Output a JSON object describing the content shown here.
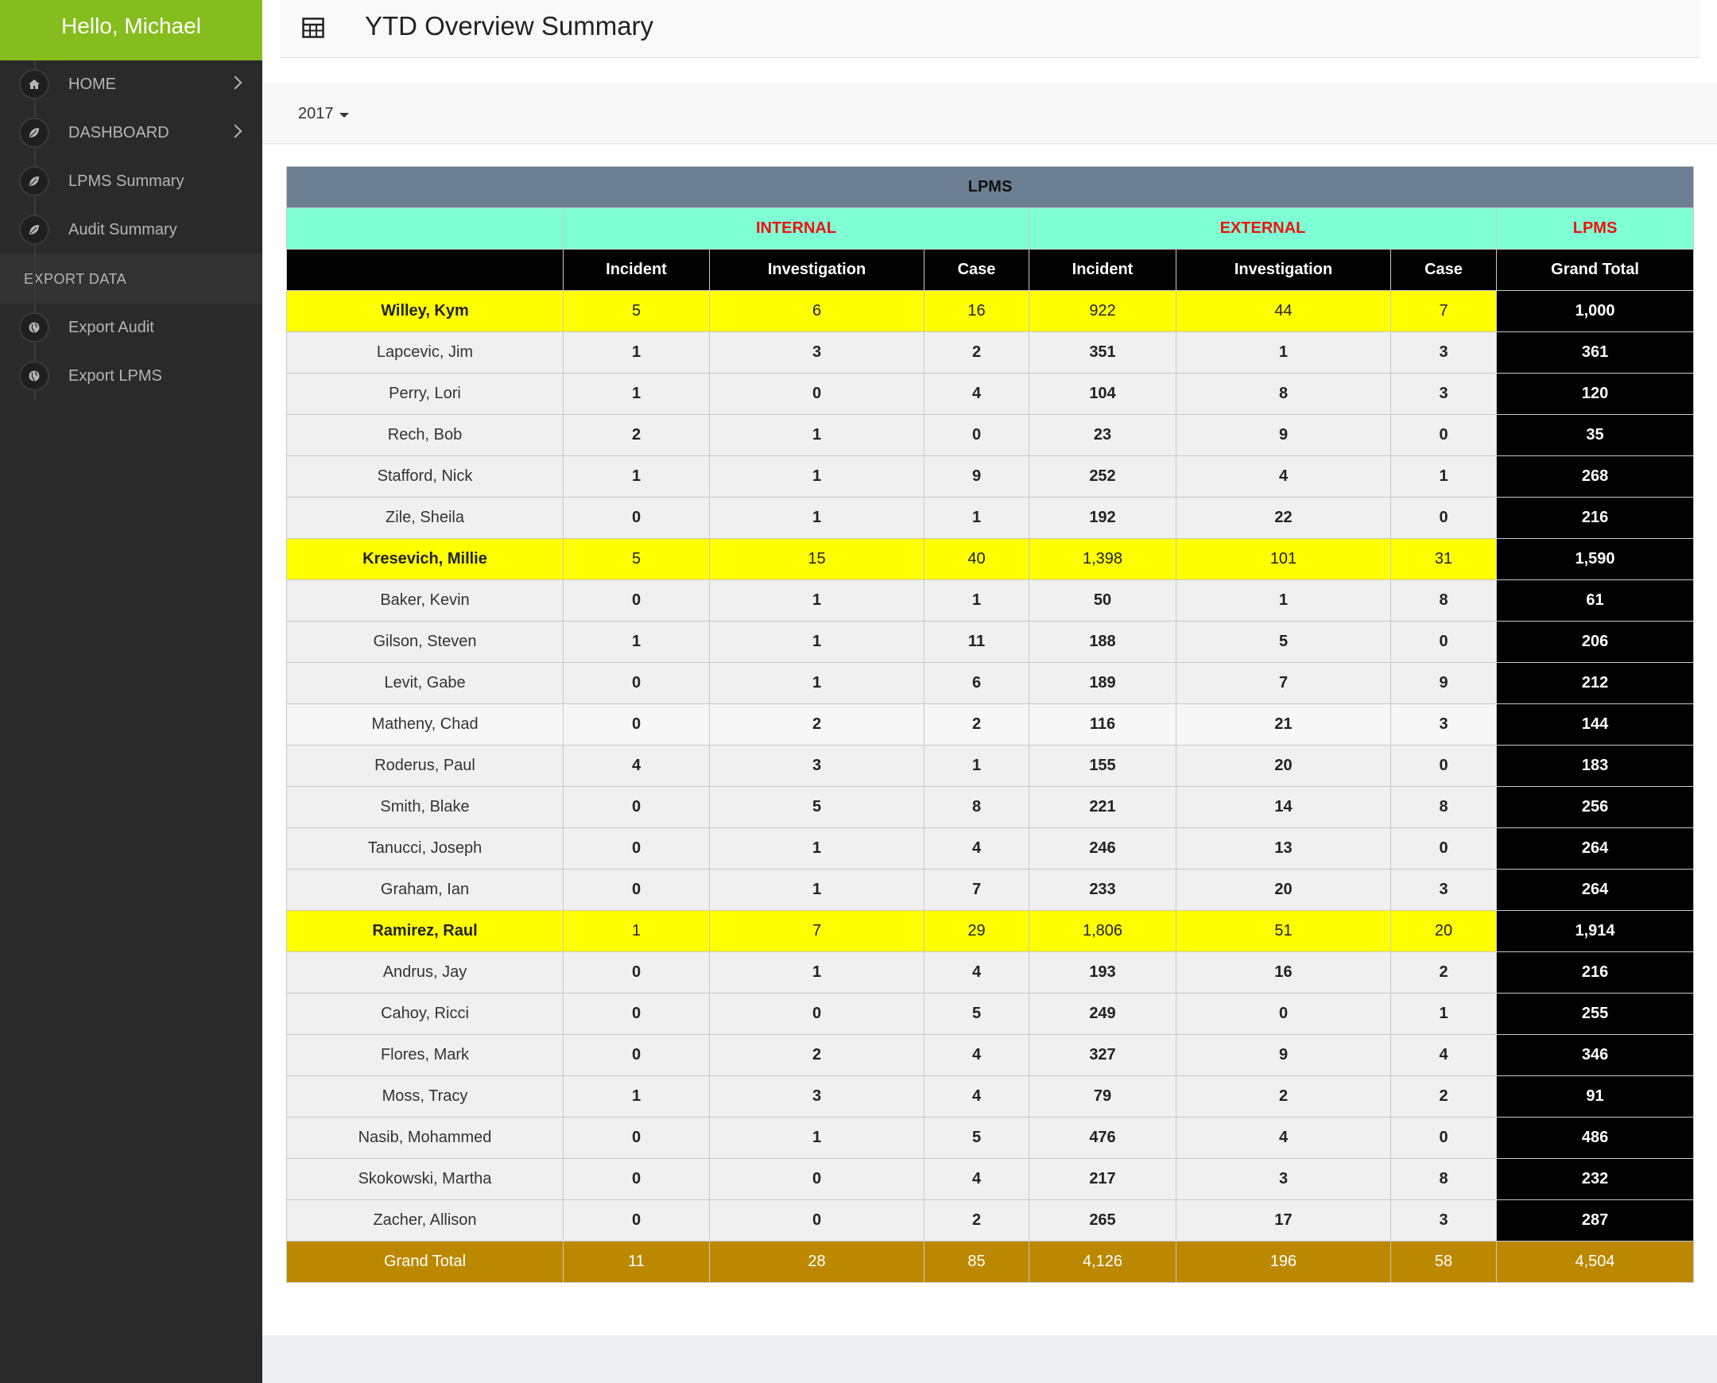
{
  "sidebar": {
    "greeting": "Hello, Michael",
    "items": [
      {
        "label": "HOME",
        "icon": "home-icon",
        "chevron": true
      },
      {
        "label": "DASHBOARD",
        "icon": "leaf-icon",
        "chevron": true
      },
      {
        "label": "LPMS Summary",
        "icon": "leaf-icon",
        "chevron": false
      },
      {
        "label": "Audit Summary",
        "icon": "leaf-icon",
        "chevron": false
      }
    ],
    "section": "EXPORT DATA",
    "export_items": [
      {
        "label": "Export Audit",
        "icon": "globe-icon"
      },
      {
        "label": "Export LPMS",
        "icon": "globe-icon"
      }
    ]
  },
  "header": {
    "title": "YTD Overview Summary",
    "icon": "table-icon"
  },
  "filter": {
    "year": "2017"
  },
  "table": {
    "title": "LPMS",
    "groups": {
      "internal": "INTERNAL",
      "external": "EXTERNAL",
      "lpms": "LPMS"
    },
    "columns": [
      "Incident",
      "Investigation",
      "Case",
      "Incident",
      "Investigation",
      "Case",
      "Grand Total"
    ],
    "rows": [
      {
        "type": "manager",
        "name": "Willey, Kym",
        "values": [
          "5",
          "6",
          "16",
          "922",
          "44",
          "7"
        ],
        "total": "1,000"
      },
      {
        "type": "emp",
        "name": "Lapcevic, Jim",
        "values": [
          "1",
          "3",
          "2",
          "351",
          "1",
          "3"
        ],
        "total": "361"
      },
      {
        "type": "emp",
        "name": "Perry, Lori",
        "values": [
          "1",
          "0",
          "4",
          "104",
          "8",
          "3"
        ],
        "total": "120"
      },
      {
        "type": "emp",
        "name": "Rech, Bob",
        "values": [
          "2",
          "1",
          "0",
          "23",
          "9",
          "0"
        ],
        "total": "35"
      },
      {
        "type": "emp",
        "name": "Stafford, Nick",
        "values": [
          "1",
          "1",
          "9",
          "252",
          "4",
          "1"
        ],
        "total": "268"
      },
      {
        "type": "emp",
        "name": "Zile, Sheila",
        "values": [
          "0",
          "1",
          "1",
          "192",
          "22",
          "0"
        ],
        "total": "216"
      },
      {
        "type": "manager",
        "name": "Kresevich, Millie",
        "values": [
          "5",
          "15",
          "40",
          "1,398",
          "101",
          "31"
        ],
        "total": "1,590"
      },
      {
        "type": "emp",
        "name": "Baker, Kevin",
        "values": [
          "0",
          "1",
          "1",
          "50",
          "1",
          "8"
        ],
        "total": "61"
      },
      {
        "type": "emp",
        "name": "Gilson, Steven",
        "values": [
          "1",
          "1",
          "11",
          "188",
          "5",
          "0"
        ],
        "total": "206"
      },
      {
        "type": "emp",
        "name": "Levit, Gabe",
        "values": [
          "0",
          "1",
          "6",
          "189",
          "7",
          "9"
        ],
        "total": "212"
      },
      {
        "type": "emp",
        "name": "Matheny, Chad",
        "values": [
          "0",
          "2",
          "2",
          "116",
          "21",
          "3"
        ],
        "total": "144"
      },
      {
        "type": "emp",
        "name": "Roderus, Paul",
        "values": [
          "4",
          "3",
          "1",
          "155",
          "20",
          "0"
        ],
        "total": "183"
      },
      {
        "type": "emp",
        "name": "Smith, Blake",
        "values": [
          "0",
          "5",
          "8",
          "221",
          "14",
          "8"
        ],
        "total": "256"
      },
      {
        "type": "emp",
        "name": "Tanucci, Joseph",
        "values": [
          "0",
          "1",
          "4",
          "246",
          "13",
          "0"
        ],
        "total": "264"
      },
      {
        "type": "emp",
        "name": "Graham, Ian",
        "values": [
          "0",
          "1",
          "7",
          "233",
          "20",
          "3"
        ],
        "total": "264"
      },
      {
        "type": "manager",
        "name": "Ramirez, Raul",
        "values": [
          "1",
          "7",
          "29",
          "1,806",
          "51",
          "20"
        ],
        "total": "1,914"
      },
      {
        "type": "emp",
        "name": "Andrus, Jay",
        "values": [
          "0",
          "1",
          "4",
          "193",
          "16",
          "2"
        ],
        "total": "216"
      },
      {
        "type": "emp",
        "name": "Cahoy, Ricci",
        "values": [
          "0",
          "0",
          "5",
          "249",
          "0",
          "1"
        ],
        "total": "255"
      },
      {
        "type": "emp",
        "name": "Flores, Mark",
        "values": [
          "0",
          "2",
          "4",
          "327",
          "9",
          "4"
        ],
        "total": "346"
      },
      {
        "type": "emp",
        "name": "Moss, Tracy",
        "values": [
          "1",
          "3",
          "4",
          "79",
          "2",
          "2"
        ],
        "total": "91"
      },
      {
        "type": "emp",
        "name": "Nasib, Mohammed",
        "values": [
          "0",
          "1",
          "5",
          "476",
          "4",
          "0"
        ],
        "total": "486"
      },
      {
        "type": "emp",
        "name": "Skokowski, Martha",
        "values": [
          "0",
          "0",
          "4",
          "217",
          "3",
          "8"
        ],
        "total": "232"
      },
      {
        "type": "emp",
        "name": "Zacher, Allison",
        "values": [
          "0",
          "0",
          "2",
          "265",
          "17",
          "3"
        ],
        "total": "287"
      }
    ],
    "grand_total": {
      "name": "Grand Total",
      "values": [
        "11",
        "28",
        "85",
        "4,126",
        "196",
        "58"
      ],
      "total": "4,504"
    }
  },
  "colors": {
    "sidebar_bg": "#2a2a2a",
    "greeting_bg": "#86bd1e",
    "title_row_bg": "#6d7f92",
    "group_row_bg": "#7fffd4",
    "group_text": "#ee1111",
    "manager_row_bg": "#ffff00",
    "grand_total_row_bg": "#bb8800"
  }
}
